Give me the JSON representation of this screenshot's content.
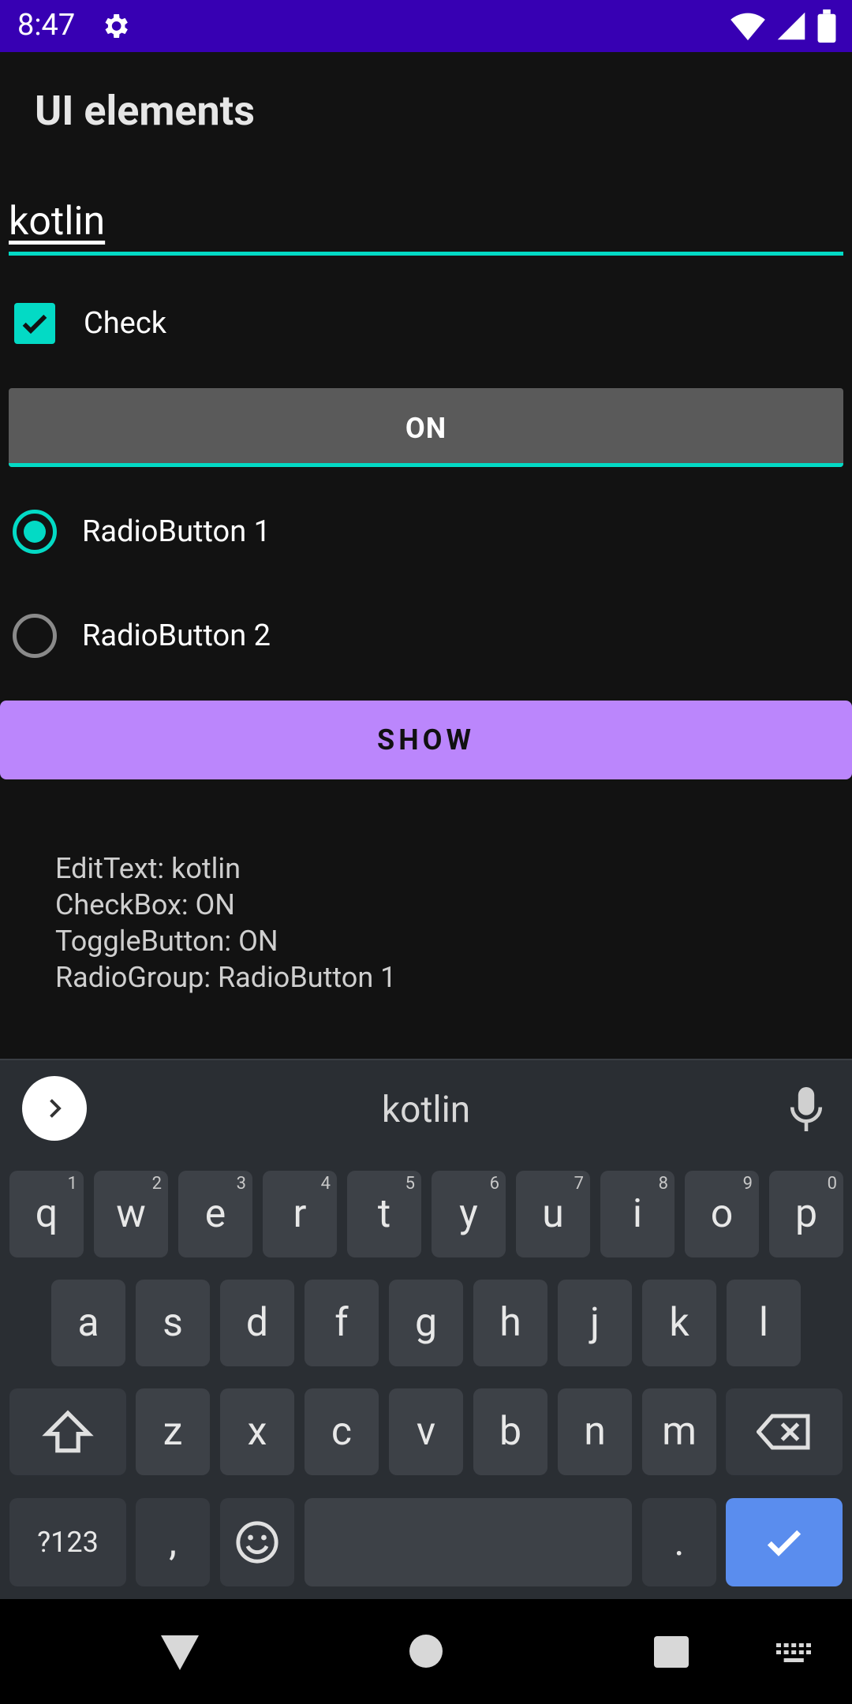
{
  "status_bar": {
    "time": "8:47"
  },
  "app": {
    "title": "UI elements"
  },
  "edittext": {
    "value": "kotlin"
  },
  "checkbox": {
    "label": "Check",
    "checked": true
  },
  "toggle": {
    "label": "ON",
    "state": "on"
  },
  "radio_group": [
    {
      "label": "RadioButton 1",
      "checked": true
    },
    {
      "label": "RadioButton 2",
      "checked": false
    }
  ],
  "show_button": {
    "label": "SHOW"
  },
  "result": {
    "line1": "EditText: kotlin",
    "line2": "CheckBox: ON",
    "line3": "ToggleButton: ON",
    "line4": "RadioGroup: RadioButton 1"
  },
  "keyboard": {
    "suggestion": "kotlin",
    "row1": [
      {
        "k": "q",
        "h": "1"
      },
      {
        "k": "w",
        "h": "2"
      },
      {
        "k": "e",
        "h": "3"
      },
      {
        "k": "r",
        "h": "4"
      },
      {
        "k": "t",
        "h": "5"
      },
      {
        "k": "y",
        "h": "6"
      },
      {
        "k": "u",
        "h": "7"
      },
      {
        "k": "i",
        "h": "8"
      },
      {
        "k": "o",
        "h": "9"
      },
      {
        "k": "p",
        "h": "0"
      }
    ],
    "row2": [
      "a",
      "s",
      "d",
      "f",
      "g",
      "h",
      "j",
      "k",
      "l"
    ],
    "row3": [
      "z",
      "x",
      "c",
      "v",
      "b",
      "n",
      "m"
    ],
    "symbols_label": "?123",
    "comma": ",",
    "period": "."
  },
  "colors": {
    "status_bar": "#3700b3",
    "accent": "#03dac5",
    "primary_button": "#bb86fc",
    "background": "#121212",
    "keyboard_action": "#5a8dee"
  }
}
